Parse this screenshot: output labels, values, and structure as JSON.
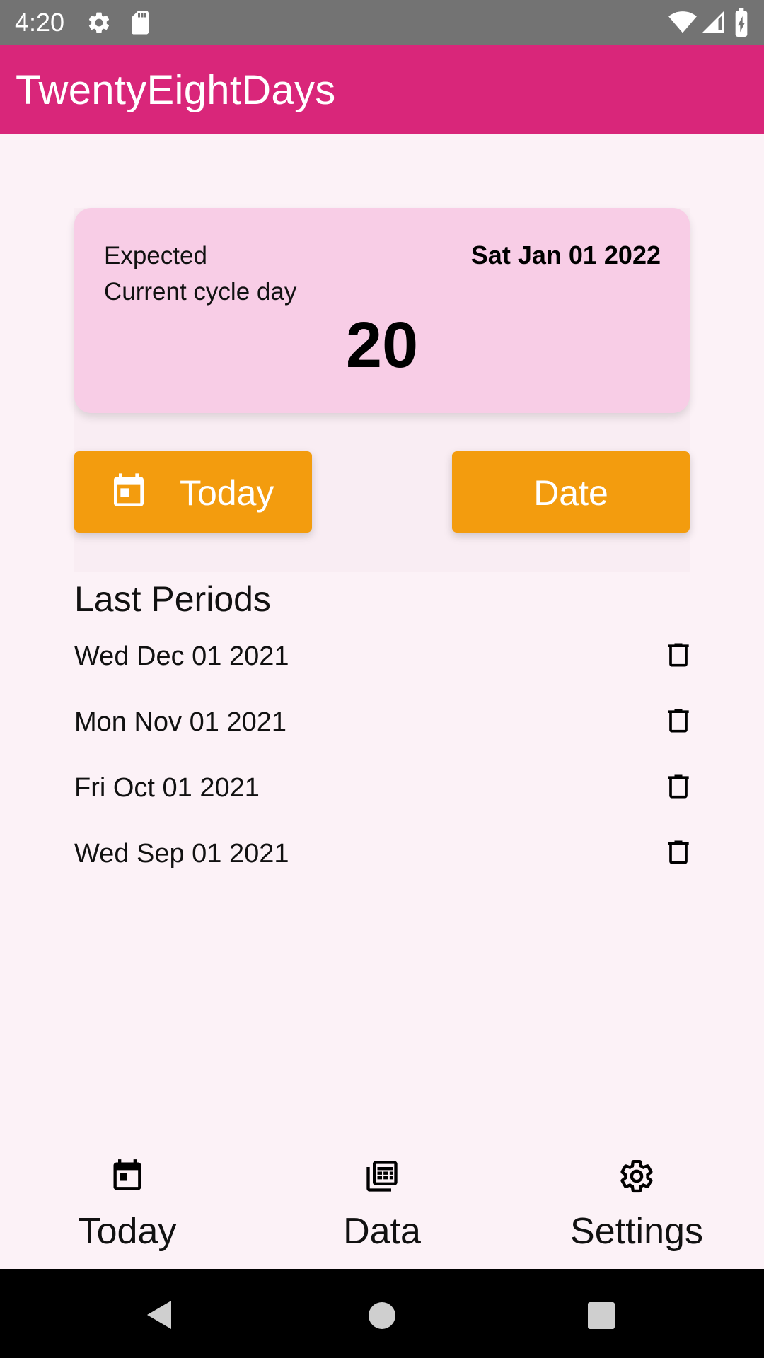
{
  "status_bar": {
    "time": "4:20",
    "icons": [
      "gear-icon",
      "sd-card-icon",
      "wifi-icon",
      "signal-icon",
      "battery-charging-icon"
    ]
  },
  "app_bar": {
    "title": "TwentyEightDays"
  },
  "cycle_card": {
    "expected_label": "Expected",
    "expected_date": "Sat Jan 01 2022",
    "cycle_label": "Current cycle day",
    "cycle_day": "20"
  },
  "buttons": {
    "today_label": "Today",
    "date_label": "Date"
  },
  "last_periods": {
    "title": "Last Periods",
    "items": [
      {
        "date": "Wed Dec 01 2021"
      },
      {
        "date": "Mon Nov 01 2021"
      },
      {
        "date": "Fri Oct 01 2021"
      },
      {
        "date": "Wed Sep 01 2021"
      }
    ]
  },
  "bottom_nav": {
    "items": [
      {
        "label": "Today",
        "icon": "calendar-today-icon"
      },
      {
        "label": "Data",
        "icon": "data-table-icon"
      },
      {
        "label": "Settings",
        "icon": "settings-gear-icon"
      }
    ]
  },
  "system_nav": {
    "icons": [
      "back-icon",
      "home-icon",
      "recents-icon"
    ]
  },
  "colors": {
    "app_bar": "#d9267a",
    "status_bar": "#737373",
    "background": "#fcf2f7",
    "card": "#f8cde6",
    "button": "#f39c0e"
  }
}
